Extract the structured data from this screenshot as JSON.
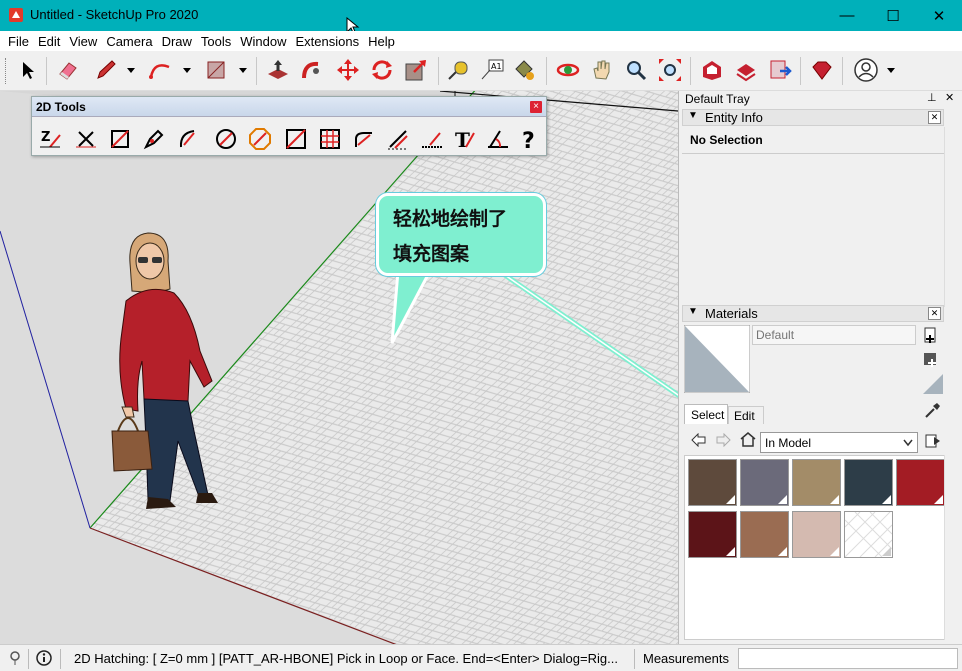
{
  "window": {
    "title": "Untitled - SketchUp Pro 2020",
    "minimize": "—",
    "maximize": "☐",
    "close": "✕"
  },
  "menu": [
    "File",
    "Edit",
    "View",
    "Camera",
    "Draw",
    "Tools",
    "Window",
    "Extensions",
    "Help"
  ],
  "tools2d": {
    "title": "2D Tools",
    "close": "×",
    "icons": [
      "z-line-icon",
      "x-line-icon",
      "rectangle-icon",
      "pen-icon",
      "arc-icon",
      "circle-icon",
      "polygon-icon",
      "square-icon",
      "hatch-icon",
      "fillet-icon",
      "offset-icon",
      "dim-line-icon",
      "text-icon",
      "angle-icon",
      "help-icon"
    ]
  },
  "callout": {
    "line1": "轻松地绘制了",
    "line2": "填充图案"
  },
  "tray": {
    "title": "Default Tray",
    "entity_info": {
      "title": "Entity Info",
      "selection": "No Selection"
    },
    "materials": {
      "title": "Materials",
      "name_placeholder": "Default",
      "tabs": [
        "Select",
        "Edit"
      ],
      "library": "In Model",
      "swatch_colors": [
        "#5e4a3c",
        "#6b6a7a",
        "#a38c68",
        "#2d3d48",
        "#a31c24",
        "#5c1418",
        "#9a6c52",
        "#d4bab0",
        "#ffffff"
      ]
    }
  },
  "status": {
    "message": "2D Hatching:  [ Z=0 mm ] [PATT_AR-HBONE] Pick in Loop or Face. End=<Enter> Dialog=Rig...",
    "measurements_label": "Measurements"
  },
  "colors": {
    "titlebar": "#00b0ba",
    "callout": "#7fefd0",
    "shirt": "#b5202a"
  }
}
